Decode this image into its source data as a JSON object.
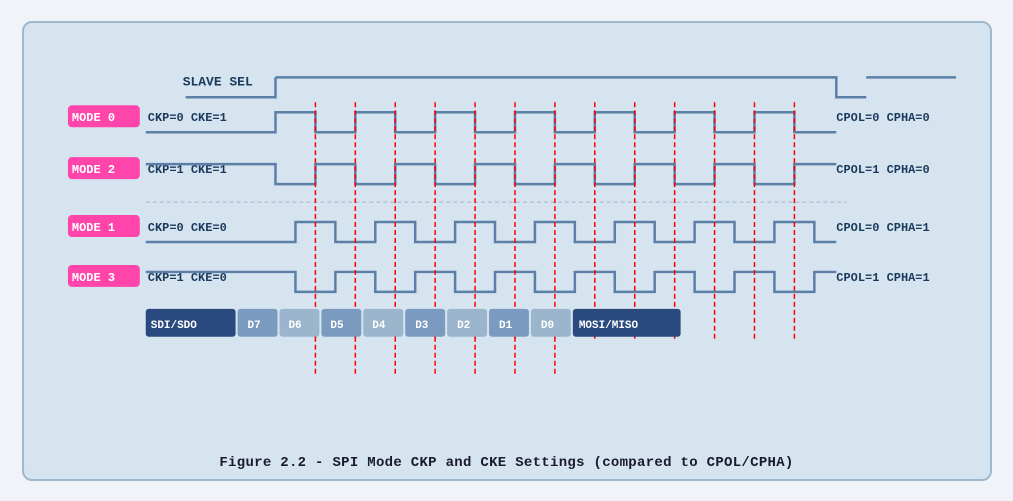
{
  "caption": "Figure 2.2 - SPI Mode CKP and CKE Settings (compared to CPOL/CPHA)",
  "diagram": {
    "slave_sel_label": "SLAVE SEL",
    "modes": [
      {
        "label": "MODE 0",
        "params": "CKP=0  CKE=1",
        "right": "CPOL=0  CPHA=0"
      },
      {
        "label": "MODE 2",
        "params": "CKP=1  CKE=1",
        "right": "CPOL=1  CPHA=0"
      },
      {
        "label": "MODE 1",
        "params": "CKP=0  CKE=0",
        "right": "CPOL=0  CPHA=1"
      },
      {
        "label": "MODE 3",
        "params": "CKP=1  CKE=0",
        "right": "CPOL=1  CPHA=1"
      }
    ],
    "data_bits": [
      "SDI/SDO",
      "D7",
      "D6",
      "D5",
      "D4",
      "D3",
      "D2",
      "D1",
      "D0",
      "MOSI/MISO"
    ]
  }
}
